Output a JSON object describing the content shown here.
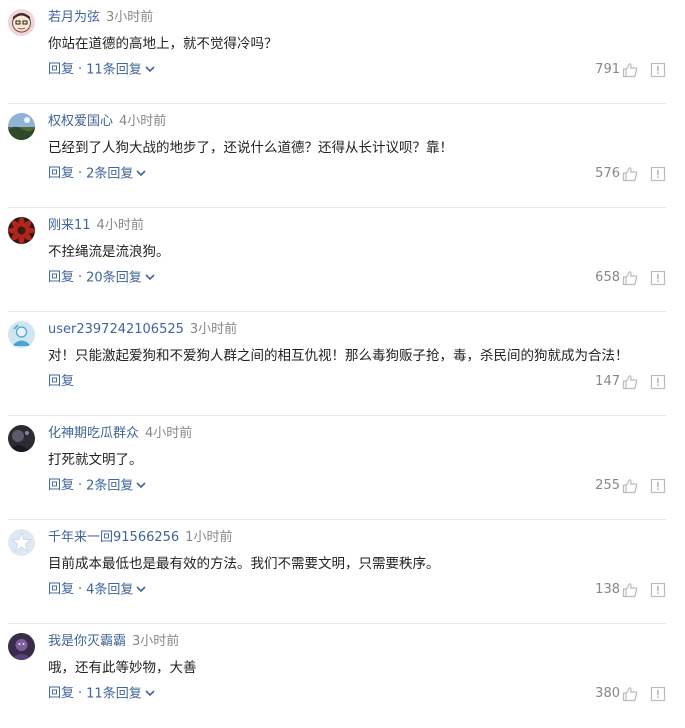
{
  "comments": [
    {
      "username": "若月为弦",
      "time": "3小时前",
      "text": "你站在道德的高地上，就不觉得冷吗？",
      "reply_label": "回复",
      "reply_count": "11条回复",
      "likes": "791",
      "avatar": "cartoon-face"
    },
    {
      "username": "权权爱国心",
      "time": "4小时前",
      "text": "已经到了人狗大战的地步了，还说什么道德？还得从长计议呗？靠！",
      "reply_label": "回复",
      "reply_count": "2条回复",
      "likes": "576",
      "avatar": "landscape"
    },
    {
      "username": "刚来11",
      "time": "4小时前",
      "text": "不拴绳流是流浪狗。",
      "reply_label": "回复",
      "reply_count": "20条回复",
      "likes": "658",
      "avatar": "flower"
    },
    {
      "username": "user2397242106525",
      "time": "3小时前",
      "text": "对！只能激起爱狗和不爱狗人群之间的相互仇视！那么毒狗贩子抢，毒，杀民间的狗就成为合法！",
      "reply_label": "回复",
      "reply_count": "",
      "likes": "147",
      "avatar": "default-user"
    },
    {
      "username": "化神期吃瓜群众",
      "time": "4小时前",
      "text": "打死就文明了。",
      "reply_label": "回复",
      "reply_count": "2条回复",
      "likes": "255",
      "avatar": "dark-photo"
    },
    {
      "username": "千年来一回91566256",
      "time": "1小时前",
      "text": "目前成本最低也是最有效的方法。我们不需要文明，只需要秩序。",
      "reply_label": "回复",
      "reply_count": "4条回复",
      "likes": "138",
      "avatar": "star-default"
    },
    {
      "username": "我是你灭霸霸",
      "time": "3小时前",
      "text": "哦，还有此等妙物，大善",
      "reply_label": "回复",
      "reply_count": "11条回复",
      "likes": "380",
      "avatar": "purple-photo"
    }
  ],
  "separator": "·",
  "icons": {
    "like": "thumbs-up-icon",
    "report": "report-icon",
    "expand": "chevron-down-icon"
  },
  "colors": {
    "link": "#406599",
    "muted": "#888888",
    "text": "#222222",
    "divider": "#e6e6e6"
  }
}
